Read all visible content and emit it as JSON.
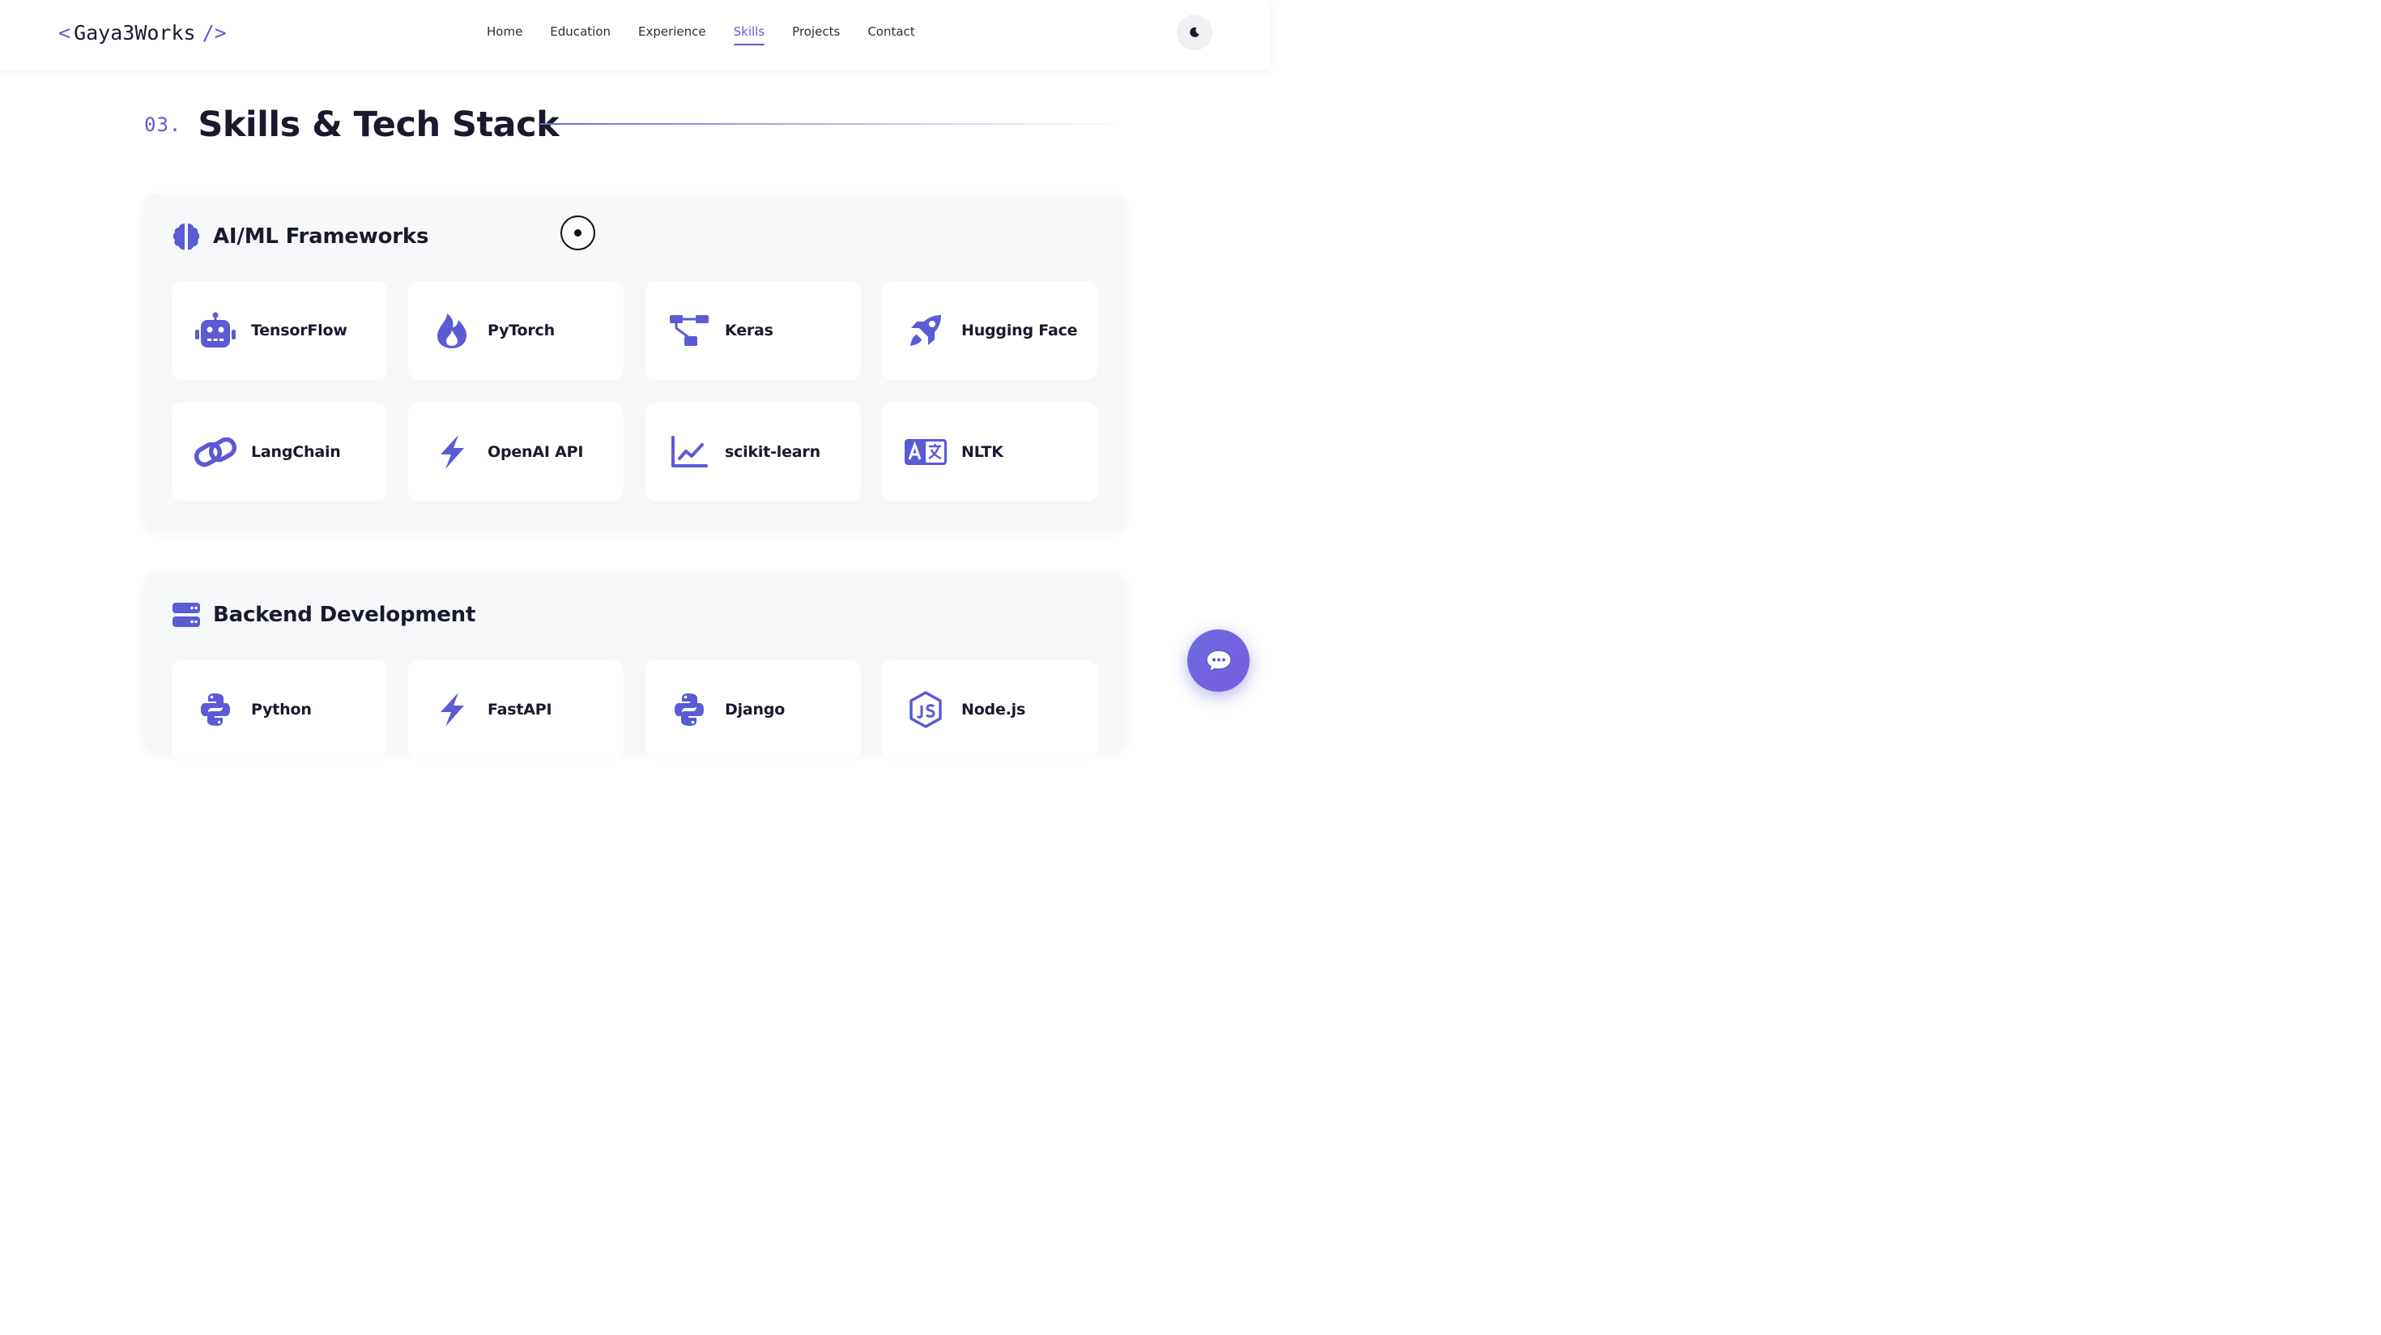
{
  "nav": {
    "logo_open": "<",
    "logo_text": "Gaya3Works",
    "logo_close": "/>",
    "links": [
      {
        "label": "Home"
      },
      {
        "label": "Education"
      },
      {
        "label": "Experience"
      },
      {
        "label": "Skills",
        "active": true
      },
      {
        "label": "Projects"
      },
      {
        "label": "Contact"
      }
    ],
    "theme_icon": "moon-icon"
  },
  "section": {
    "number": "03.",
    "title": "Skills & Tech Stack"
  },
  "categories": [
    {
      "title": "AI/ML Frameworks",
      "icon": "brain-icon",
      "skills": [
        {
          "label": "TensorFlow",
          "icon": "robot-icon"
        },
        {
          "label": "PyTorch",
          "icon": "fire-icon"
        },
        {
          "label": "Keras",
          "icon": "diagram-icon"
        },
        {
          "label": "Hugging Face",
          "icon": "rocket-icon"
        },
        {
          "label": "LangChain",
          "icon": "link-icon"
        },
        {
          "label": "OpenAI API",
          "icon": "bolt-icon"
        },
        {
          "label": "scikit-learn",
          "icon": "chart-line-icon"
        },
        {
          "label": "NLTK",
          "icon": "language-icon"
        }
      ]
    },
    {
      "title": "Backend Development",
      "icon": "server-icon",
      "skills": [
        {
          "label": "Python",
          "icon": "python-icon"
        },
        {
          "label": "FastAPI",
          "icon": "bolt-icon"
        },
        {
          "label": "Django",
          "icon": "python-icon"
        },
        {
          "label": "Node.js",
          "icon": "nodejs-icon"
        }
      ]
    }
  ],
  "chat": {
    "icon": "chat-bubble-icon"
  },
  "colors": {
    "accent": "#5b5bd6",
    "text": "#1a1a2e",
    "panel": "#f7f8fa"
  }
}
